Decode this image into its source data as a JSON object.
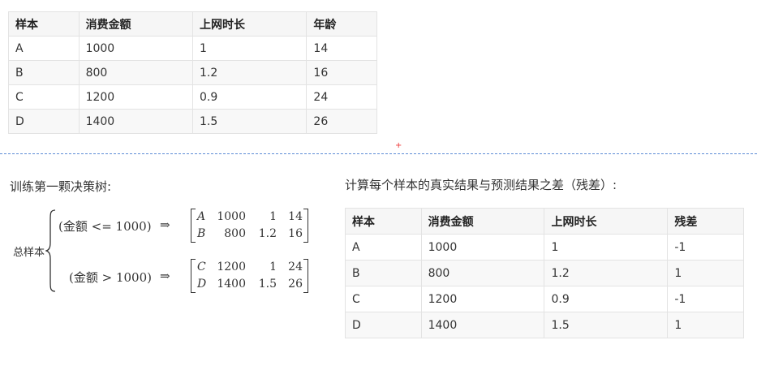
{
  "table1": {
    "headers": [
      "样本",
      "消费金额",
      "上网时长",
      "年龄"
    ],
    "rows": [
      [
        "A",
        "1000",
        "1",
        "14"
      ],
      [
        "B",
        "800",
        "1.2",
        "16"
      ],
      [
        "C",
        "1200",
        "0.9",
        "24"
      ],
      [
        "D",
        "1400",
        "1.5",
        "26"
      ]
    ]
  },
  "marker": "+",
  "left_heading": "训练第一颗决策树:",
  "right_heading": "计算每个样本的真实结果与预测结果之差（残差）:",
  "tree": {
    "root_label": "总样本",
    "arrow": "⇒",
    "branches": [
      {
        "condition": "(金额 <= 1000)",
        "rows": [
          [
            "A",
            "1000",
            "1",
            "14"
          ],
          [
            "B",
            "800",
            "1.2",
            "16"
          ]
        ]
      },
      {
        "condition": "(金额 > 1000)",
        "rows": [
          [
            "C",
            "1200",
            "1",
            "24"
          ],
          [
            "D",
            "1400",
            "1.5",
            "26"
          ]
        ]
      }
    ]
  },
  "table2": {
    "headers": [
      "样本",
      "消费金额",
      "上网时长",
      "残差"
    ],
    "rows": [
      [
        "A",
        "1000",
        "1",
        "-1"
      ],
      [
        "B",
        "800",
        "1.2",
        "1"
      ],
      [
        "C",
        "1200",
        "0.9",
        "-1"
      ],
      [
        "D",
        "1400",
        "1.5",
        "1"
      ]
    ]
  }
}
